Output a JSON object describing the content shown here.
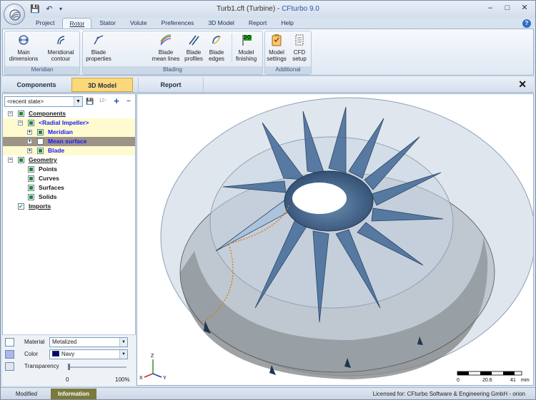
{
  "window": {
    "title_file": "Turb1.cft (Turbine)",
    "title_sep": " - ",
    "title_product": "CFturbo 9.0",
    "controls": [
      "–",
      "□",
      "✕"
    ]
  },
  "ribbon_tabs": [
    "Project",
    "Rotor",
    "Stator",
    "Volute",
    "Preferences",
    "3D Model",
    "Report",
    "Help"
  ],
  "ribbon": {
    "meridian": {
      "label": "Meridian",
      "buttons": [
        [
          "Main",
          "dimensions"
        ],
        [
          "Meridional",
          "contour"
        ]
      ]
    },
    "blading": {
      "label": "Blading",
      "buttons": [
        [
          "Blade",
          "properties"
        ],
        [
          "Blade",
          "mean lines"
        ],
        [
          "Blade",
          "profiles"
        ],
        [
          "Blade",
          "edges"
        ],
        [
          "Model",
          "finishing"
        ]
      ]
    },
    "additional": {
      "label": "Additional",
      "buttons": [
        [
          "Model",
          "settings"
        ],
        [
          "CFD",
          "setup"
        ]
      ]
    }
  },
  "subtabs": [
    "Components",
    "3D Model",
    "Report"
  ],
  "left": {
    "state_combo": "<recent state>",
    "toolbar": [
      "💾",
      "12↑",
      "+",
      "–"
    ],
    "tree": [
      {
        "label": "Components",
        "level": 0,
        "exp": "−",
        "check": "on",
        "style": "u"
      },
      {
        "label": "<Radial Impeller>",
        "level": 1,
        "exp": "−",
        "check": "on",
        "style": "blue"
      },
      {
        "label": "Meridian",
        "level": 2,
        "exp": "+",
        "check": "on",
        "style": "blue"
      },
      {
        "label": "Mean surface",
        "level": 2,
        "exp": "+",
        "check": "off",
        "style": "blue"
      },
      {
        "label": "Blade",
        "level": 2,
        "exp": "+",
        "check": "on",
        "style": "blue"
      },
      {
        "label": "Geometry",
        "level": 0,
        "exp": "−",
        "check": "on",
        "style": "u"
      },
      {
        "label": "Points",
        "level": 1,
        "exp": "",
        "check": "on",
        "style": ""
      },
      {
        "label": "Curves",
        "level": 1,
        "exp": "",
        "check": "on",
        "style": ""
      },
      {
        "label": "Surfaces",
        "level": 1,
        "exp": "",
        "check": "on",
        "style": ""
      },
      {
        "label": "Solids",
        "level": 1,
        "exp": "",
        "check": "on",
        "style": ""
      },
      {
        "label": "Imports",
        "level": 0,
        "exp": "",
        "check": "tick",
        "style": "u"
      }
    ]
  },
  "properties": {
    "material_label": "Material",
    "material_value": "Metalized",
    "color_label": "Color",
    "color_value": "Navy",
    "color_hex": "#000080",
    "transparency_label": "Transparency",
    "transparency_fraction": 0,
    "transparency_min": "0",
    "transparency_max": "100%"
  },
  "viewport": {
    "axes": {
      "z": "Z",
      "x": "X",
      "y": "Y"
    },
    "scale": {
      "t0": "0",
      "t1": "20.6",
      "t2": "41",
      "unit": "mm"
    }
  },
  "status": {
    "modified": "Modified",
    "information": "Information",
    "license": "Licensed for: CFturbo Software & Engineering GmbH - orion"
  },
  "colors": {
    "accent_tab": "#fbd97a",
    "info_tab": "#7b7a3d",
    "blade": "#4a6f9a"
  }
}
